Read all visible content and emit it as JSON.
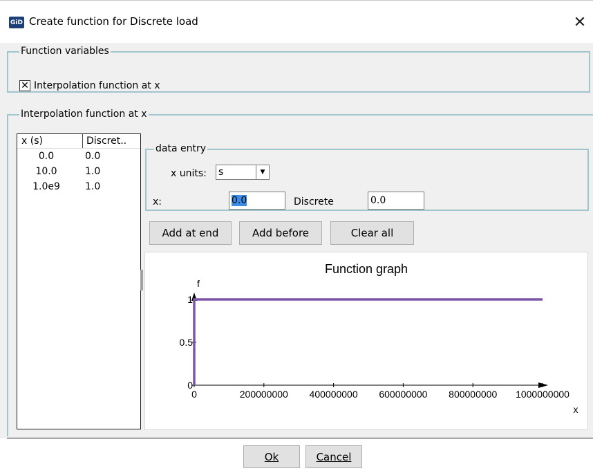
{
  "window": {
    "icon_text": "GiD",
    "title": "Create function for Discrete load",
    "close_glyph": "✕"
  },
  "function_variables": {
    "legend": "Function variables",
    "checkbox_checked": true,
    "checkbox_mark": "✕",
    "checkbox_label": "Interpolation function at x"
  },
  "interpolation": {
    "legend": "Interpolation function at x",
    "table": {
      "columns": [
        "x (s)",
        "Discret.."
      ],
      "rows": [
        [
          "0.0",
          "0.0"
        ],
        [
          "10.0",
          "1.0"
        ],
        [
          "1.0e9",
          "1.0"
        ]
      ]
    },
    "data_entry": {
      "legend": "data entry",
      "units_label": "x units:",
      "units_value": "s",
      "x_label": "x:",
      "x_value": "0.0",
      "discrete_label": "Discrete",
      "discrete_value": "0.0"
    },
    "buttons": {
      "add_at_end": "Add at end",
      "add_before": "Add before",
      "clear_all": "Clear all"
    }
  },
  "chart_data": {
    "type": "line",
    "title": "Function graph",
    "xlabel": "x",
    "ylabel": "f",
    "xlim": [
      0,
      1000000000
    ],
    "ylim": [
      0,
      1
    ],
    "x_ticks": [
      "0",
      "200000000",
      "400000000",
      "600000000",
      "800000000",
      "1000000000"
    ],
    "y_ticks": [
      "0",
      "0.5",
      "1"
    ],
    "series": [
      {
        "x": [
          0,
          10,
          1000000000
        ],
        "y": [
          0,
          1,
          1
        ],
        "color": "#7d55a8"
      }
    ],
    "grid": false
  },
  "footer": {
    "ok_label": "Ok",
    "cancel_label": "Cancel"
  }
}
